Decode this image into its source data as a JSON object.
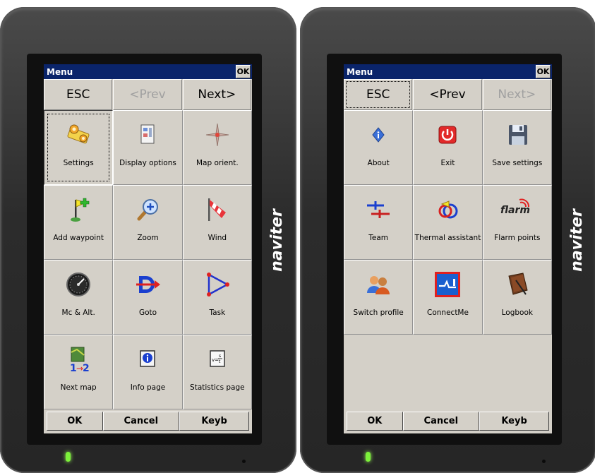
{
  "brand": "naviter",
  "left": {
    "title": "Menu",
    "title_ok": "OK",
    "nav": {
      "esc": "ESC",
      "prev": "<Prev",
      "next": "Next>"
    },
    "items": [
      {
        "label": "Settings",
        "icon": "settings-icon"
      },
      {
        "label": "Display options",
        "icon": "display-options-icon"
      },
      {
        "label": "Map orient.",
        "icon": "map-orientation-icon"
      },
      {
        "label": "Add waypoint",
        "icon": "add-waypoint-icon"
      },
      {
        "label": "Zoom",
        "icon": "zoom-icon"
      },
      {
        "label": "Wind",
        "icon": "wind-sock-icon"
      },
      {
        "label": "Mc & Alt.",
        "icon": "altimeter-icon"
      },
      {
        "label": "Goto",
        "icon": "goto-icon"
      },
      {
        "label": "Task",
        "icon": "task-icon"
      },
      {
        "label": "Next map",
        "icon": "next-map-icon"
      },
      {
        "label": "Info page",
        "icon": "info-page-icon"
      },
      {
        "label": "Statistics page",
        "icon": "statistics-page-icon"
      }
    ],
    "bottom": {
      "ok": "OK",
      "cancel": "Cancel",
      "keyb": "Keyb"
    }
  },
  "right": {
    "title": "Menu",
    "title_ok": "OK",
    "nav": {
      "esc": "ESC",
      "prev": "<Prev",
      "next": "Next>"
    },
    "items": [
      {
        "label": "About",
        "icon": "about-icon"
      },
      {
        "label": "Exit",
        "icon": "power-icon"
      },
      {
        "label": "Save settings",
        "icon": "floppy-disk-icon"
      },
      {
        "label": "Team",
        "icon": "team-icon"
      },
      {
        "label": "Thermal assistant",
        "icon": "thermal-assistant-icon"
      },
      {
        "label": "Flarm points",
        "icon": "flarm-icon",
        "icon_text": "flarm"
      },
      {
        "label": "Switch profile",
        "icon": "switch-profile-icon"
      },
      {
        "label": "ConnectMe",
        "icon": "connectme-icon"
      },
      {
        "label": "Logbook",
        "icon": "logbook-icon"
      }
    ],
    "bottom": {
      "ok": "OK",
      "cancel": "Cancel",
      "keyb": "Keyb"
    }
  }
}
